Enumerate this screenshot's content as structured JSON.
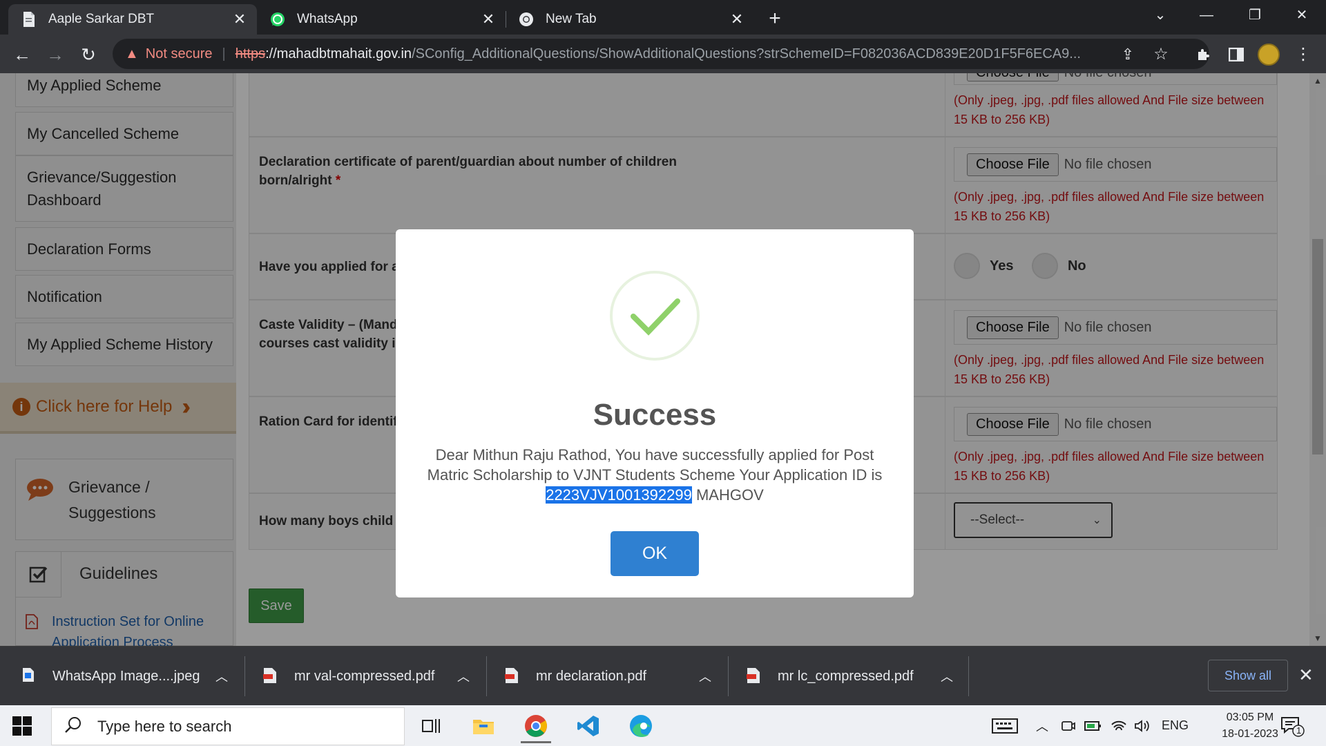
{
  "browser": {
    "tabs": [
      {
        "title": "Aaple Sarkar DBT",
        "icon": "document-icon"
      },
      {
        "title": "WhatsApp",
        "icon": "whatsapp-icon"
      },
      {
        "title": "New Tab",
        "icon": "chrome-icon"
      }
    ],
    "security_label": "Not secure",
    "url_scheme": "https",
    "url_sep": "://",
    "url_host": "mahadbtmahait.gov.in",
    "url_path": "/SConfig_AdditionalQuestions/ShowAdditionalQuestions?strSchemeID=F082036ACD839E20D1F5F6ECA9..."
  },
  "sidebar": {
    "items": [
      {
        "label": "My Applied Scheme"
      },
      {
        "label": "My Cancelled Scheme"
      },
      {
        "label": "Grievance/Suggestion Dashboard"
      },
      {
        "label": "Declaration Forms"
      },
      {
        "label": "Notification"
      },
      {
        "label": "My Applied Scheme History"
      }
    ],
    "help_label": "Click here for Help",
    "grievance_label": "Grievance / Suggestions",
    "guidelines_label": "Guidelines",
    "instruction_link": "Instruction Set for Online Application Process"
  },
  "form": {
    "q1": "Declaration certificate of parent/guardian about number of children born/alright",
    "q2": "Have you applied for any other scholarship",
    "q3a": "Caste Validity – (Mandatory for professional",
    "q3b": "courses cast validity is required)",
    "q4": "Ration Card for identification",
    "q5": "How many boys child (",
    "choose_file": "Choose File",
    "no_file": "No file chosen",
    "hint": "(Only .jpeg, .jpg, .pdf files allowed And File size between 15 KB to 256 KB)",
    "yes": "Yes",
    "no": "No",
    "select_placeholder": "--Select--",
    "save": "Save",
    "required_mark": "*"
  },
  "modal": {
    "title": "Success",
    "message_pre": "Dear Mithun Raju Rathod, You have successfully applied for Post Matric Scholarship to VJNT Students Scheme Your Application ID is",
    "application_id": "2223VJV1001392299",
    "message_post": "MAHGOV",
    "ok": "OK",
    "accent": "#8fd16a"
  },
  "downloads": [
    {
      "name": "WhatsApp Image....jpeg",
      "type": "image"
    },
    {
      "name": "mr val-compressed.pdf",
      "type": "pdf"
    },
    {
      "name": "mr declaration.pdf",
      "type": "pdf"
    },
    {
      "name": "mr lc_compressed.pdf",
      "type": "pdf"
    }
  ],
  "shelf": {
    "show_all": "Show all"
  },
  "taskbar": {
    "search_placeholder": "Type here to search",
    "lang": "ENG",
    "time": "03:05 PM",
    "date": "18-01-2023",
    "notif_count": "1"
  }
}
